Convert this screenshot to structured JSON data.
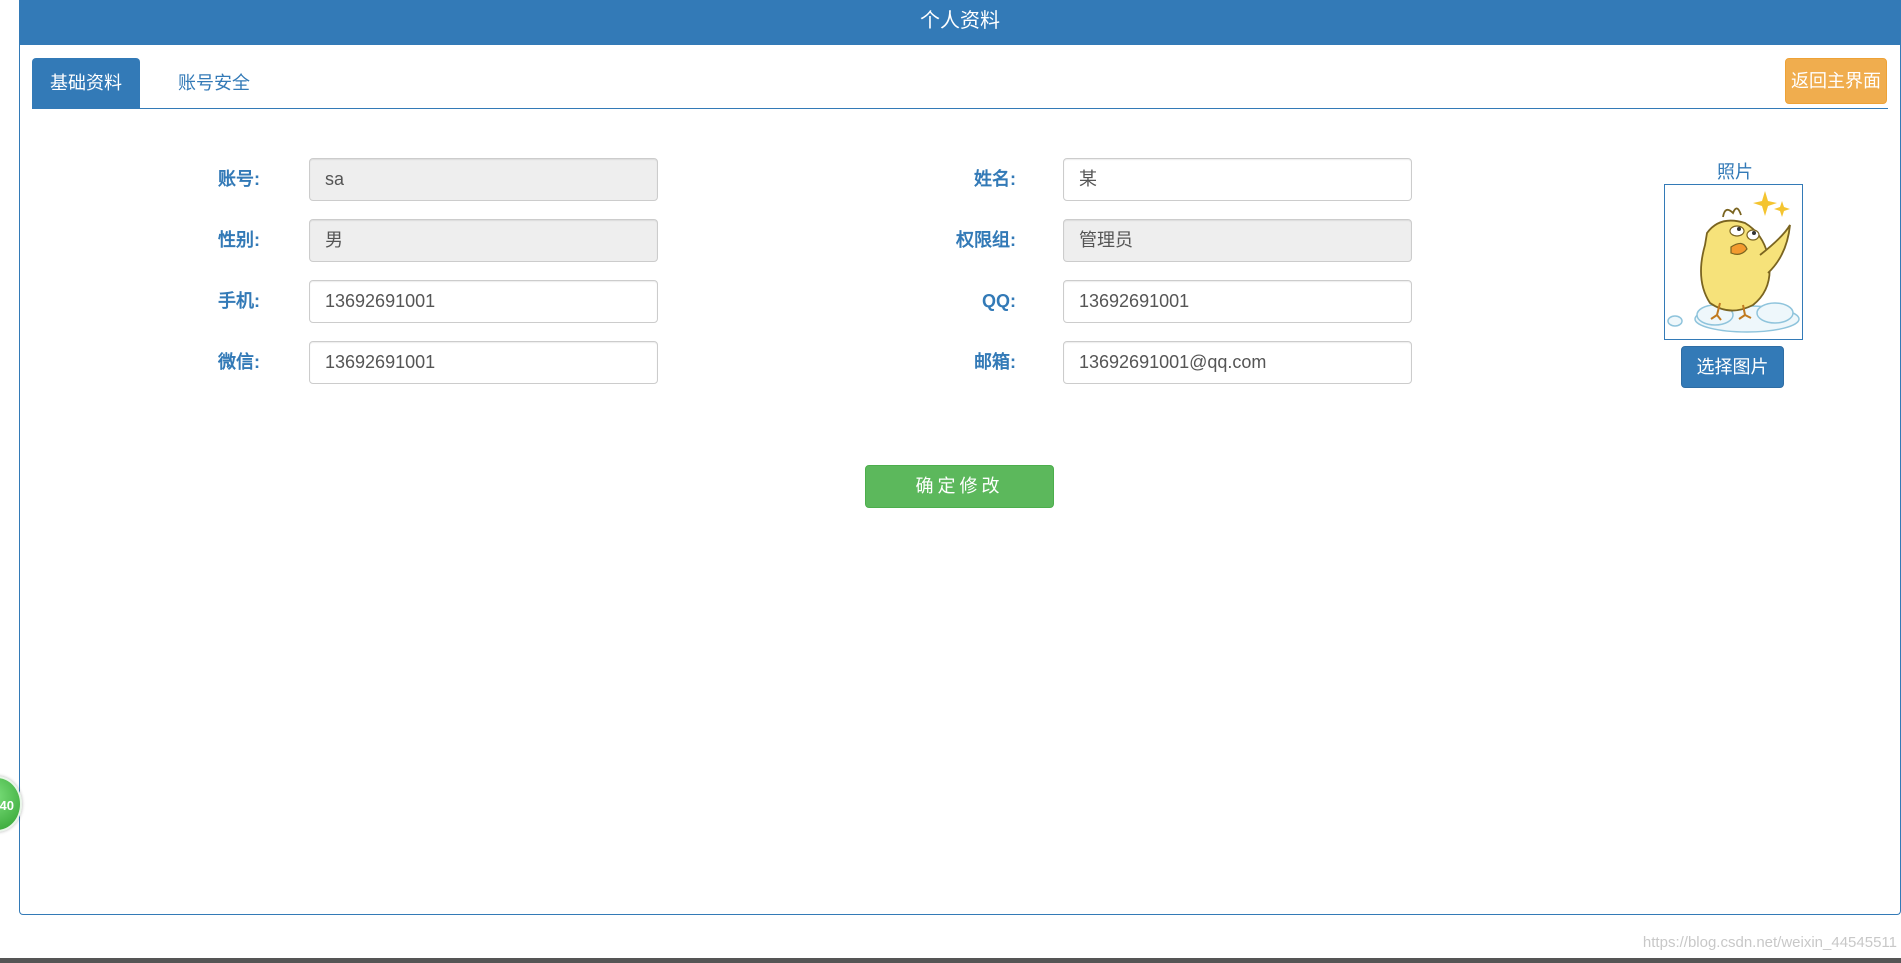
{
  "header": {
    "title": "个人资料"
  },
  "tabs": [
    {
      "label": "基础资料",
      "active": true
    },
    {
      "label": "账号安全",
      "active": false
    }
  ],
  "toolbar": {
    "back_label": "返回主界面"
  },
  "form": {
    "account": {
      "label": "账号:",
      "value": "sa",
      "readonly": true
    },
    "gender": {
      "label": "性别:",
      "value": "男",
      "readonly": true
    },
    "phone": {
      "label": "手机:",
      "value": "13692691001"
    },
    "wechat": {
      "label": "微信:",
      "value": "13692691001"
    },
    "name": {
      "label": "姓名:",
      "value": "某"
    },
    "role_group": {
      "label": "权限组:",
      "value": "管理员",
      "readonly": true
    },
    "qq": {
      "label": "QQ:",
      "value": "13692691001"
    },
    "email": {
      "label": "邮箱:",
      "value": "13692691001@qq.com"
    }
  },
  "photo": {
    "label": "照片",
    "pick_label": "选择图片"
  },
  "submit_label": "确定修改",
  "float_badge": {
    "text": "40"
  },
  "watermark": "https://blog.csdn.net/weixin_44545511",
  "colors": {
    "primary": "#337ab7",
    "warning": "#f0ad4e",
    "success": "#5cb85c",
    "readonly_bg": "#eeeeee"
  }
}
